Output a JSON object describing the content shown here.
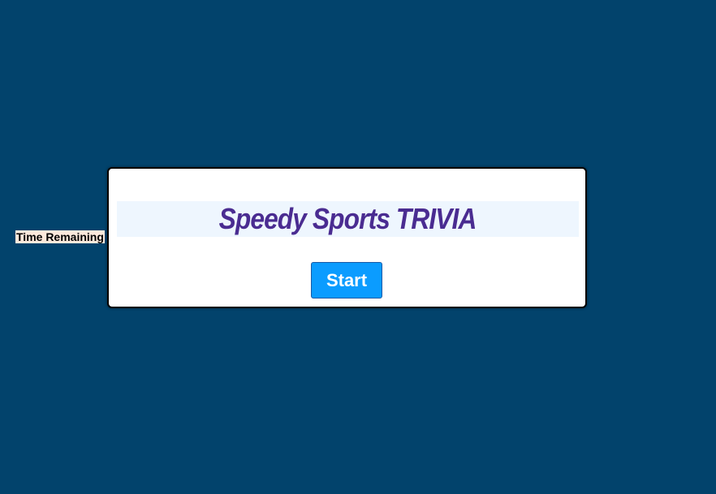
{
  "timer": {
    "label": "Time Remaining"
  },
  "card": {
    "title": "Speedy Sports TRIVIA",
    "start_label": "Start"
  },
  "colors": {
    "background": "#02436c",
    "title": "#4a2c91",
    "button": "#0b9cff"
  }
}
